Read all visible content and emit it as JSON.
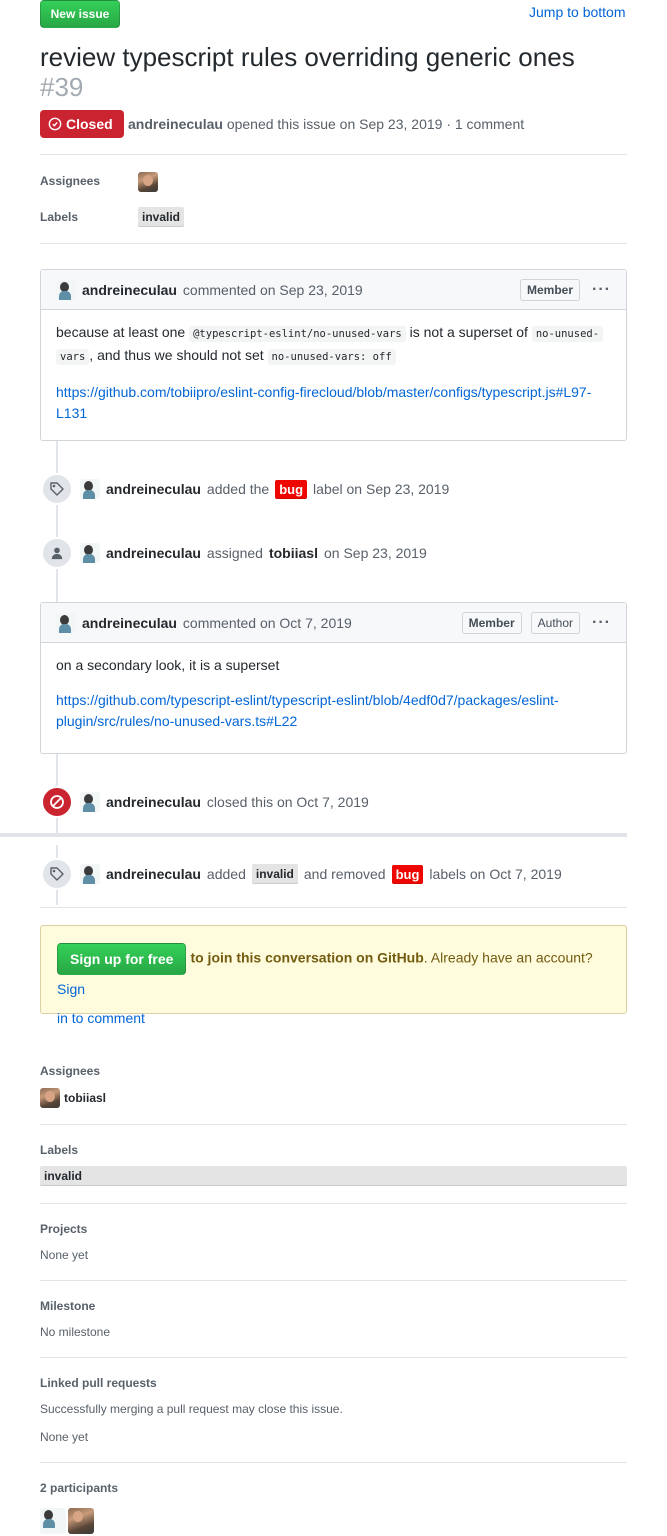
{
  "header": {
    "new_issue_label": "New issue",
    "jump_label": "Jump to bottom",
    "title": "review typescript rules overriding generic ones",
    "number": "#39",
    "state": "Closed",
    "author": "andreineculau",
    "meta_text": "opened this issue on Sep 23, 2019 · 1 comment"
  },
  "top_sidebar": {
    "assignees_heading": "Assignees",
    "labels_heading": "Labels",
    "label": "invalid"
  },
  "comment1": {
    "author": "andreineculau",
    "action": "commented on Sep 23, 2019",
    "role": "Member",
    "text_a": "because at least one",
    "code_a": "@typescript-eslint/no-unused-vars",
    "text_b": "is not a superset of",
    "code_b1": "no-unused-",
    "code_b2": "vars",
    "text_c": ", and thus we should not set",
    "code_c": "no-unused-vars: off",
    "link_line1": "https://github.com/tobiipro/eslint-config-firecloud/blob/master/configs/typescript.js#L97-",
    "link_line2": "L131"
  },
  "event_label1": {
    "author": "andreineculau",
    "pre": "added the",
    "label": "bug",
    "post": "label on Sep 23, 2019"
  },
  "event_assign": {
    "author": "andreineculau",
    "pre": "assigned",
    "target": "tobiiasl",
    "post": "on Sep 23, 2019"
  },
  "comment2": {
    "author": "andreineculau",
    "action": "commented on Oct 7, 2019",
    "role_member": "Member",
    "role_author": "Author",
    "text": "on a secondary look, it is a superset",
    "link_line1": "https://github.com/typescript-eslint/typescript-eslint/blob/4edf0d7/packages/eslint-",
    "link_line2": "plugin/src/rules/no-unused-vars.ts#L22"
  },
  "event_closed": {
    "author": "andreineculau",
    "text": "closed this on Oct 7, 2019"
  },
  "event_label2": {
    "author": "andreineculau",
    "pre": "added",
    "label_added": "invalid",
    "mid": "and removed",
    "label_removed": "bug",
    "post": "labels on Oct 7, 2019"
  },
  "signup": {
    "button": "Sign up for free",
    "bold_text": "to join this conversation on GitHub",
    "text": ". Already have an account?",
    "link_a": "Sign",
    "link_b": "in to comment"
  },
  "sidebar": {
    "assignees_heading": "Assignees",
    "assignee": "tobiiasl",
    "labels_heading": "Labels",
    "label": "invalid",
    "projects_heading": "Projects",
    "projects_value": "None yet",
    "milestone_heading": "Milestone",
    "milestone_value": "No milestone",
    "linked_heading": "Linked pull requests",
    "linked_note": "Successfully merging a pull request may close this issue.",
    "linked_value": "None yet",
    "participants_heading": "2 participants"
  },
  "colors": {
    "closed": "#cb2431",
    "bug_label": "#ee0701",
    "link": "#0366d6",
    "green_button": "#2ea44f",
    "signup_bg": "#fffbdd"
  }
}
